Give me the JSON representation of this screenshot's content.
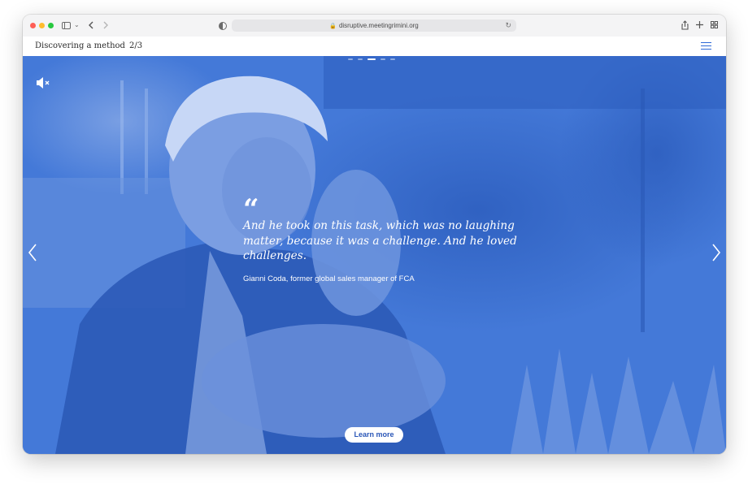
{
  "browser": {
    "url": "disruptive.meetingrimini.org",
    "icons": {
      "close": "close-light",
      "minimize": "minimize-light",
      "zoom": "zoom-light",
      "sidebar": "sidebar-icon",
      "back": "chevron-left-icon",
      "forward": "chevron-right-icon",
      "privacy": "shield-icon",
      "lock": "lock-icon",
      "reload": "reload-icon",
      "share": "share-icon",
      "new_tab": "plus-icon",
      "tabs": "tab-overview-icon"
    }
  },
  "header": {
    "title": "Discovering a method",
    "counter": "2/3",
    "menu_icon": "hamburger-menu-icon",
    "accent_color": "#2b67d6"
  },
  "hero": {
    "tint_color": "#3e74d3",
    "slides_total": 5,
    "active_slide_index": 2,
    "mute_icon": "speaker-muted-icon",
    "quote_mark": "“",
    "quote": "And he took on this task, which was no laughing matter, because it was a challenge. And he loved challenges.",
    "attribution": "Gianni Coda, former global sales manager of FCA",
    "prev_icon": "chevron-left-icon",
    "next_icon": "chevron-right-icon",
    "cta_label": "Learn more"
  }
}
